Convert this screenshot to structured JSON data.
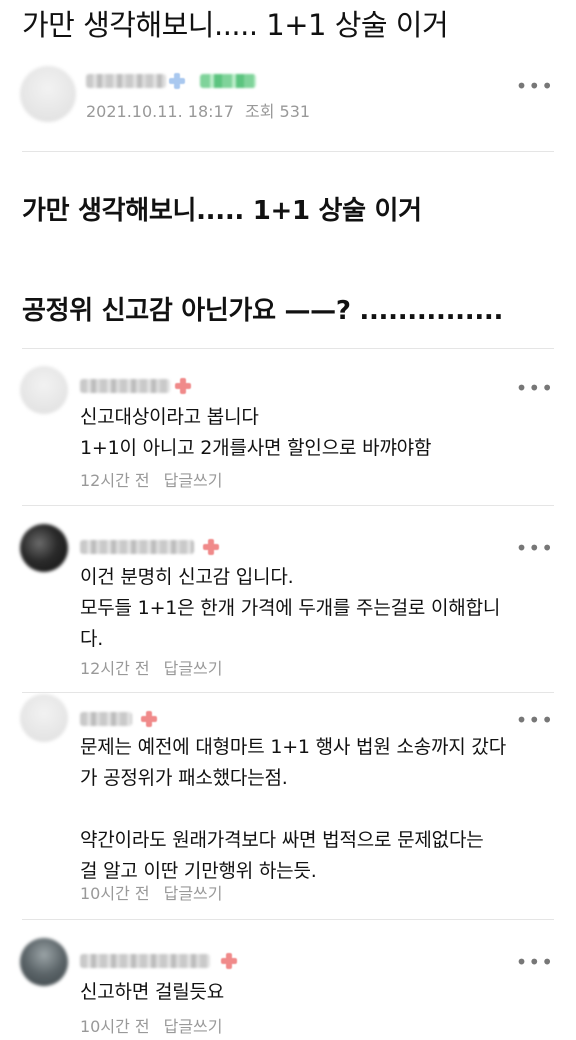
{
  "post": {
    "title": "가만 생각해보니..... 1+1 상술 이거",
    "date": "2021.10.11. 18:17",
    "views": "조회 531",
    "body_lines": [
      "가만 생각해보니..... 1+1 상술 이거",
      "공정위 신고감 아닌가요 ——? ..............."
    ]
  },
  "comments": [
    {
      "text": "신고대상이라고 봅니다\n1+1이 아니고 2개를사면 할인으로 바꺄야함",
      "time": "12시간 전",
      "reply": "답글쓰기"
    },
    {
      "text": "이건 분명히 신고감 입니다.\n모두들 1+1은 한개 가격에 두개를 주는걸로 이해합니\n다.",
      "time": "12시간 전",
      "reply": "답글쓰기"
    },
    {
      "text": "문제는 예전에 대형마트 1+1 행사 법원 소송까지 갔다\n가 공정위가 패소했다는점.\n\n약간이라도 원래가격보다 싸면 법적으로 문제없다는\n걸 알고 이딴 기만행위 하는듯.",
      "time": "10시간 전",
      "reply": "답글쓰기"
    },
    {
      "text": "신고하면 걸릴듯요",
      "time": "10시간 전",
      "reply": "답글쓰기"
    }
  ],
  "more_label": "•••",
  "icons": {
    "more": "more-options-icon",
    "avatar": "avatar",
    "badge": "member-badge-icon"
  }
}
